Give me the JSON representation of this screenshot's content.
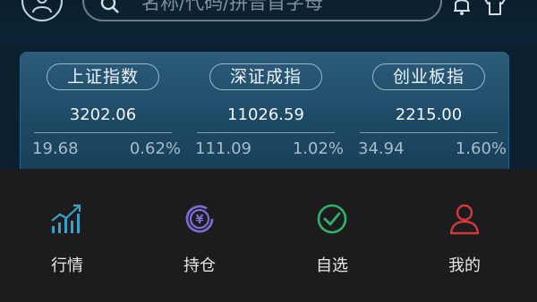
{
  "search": {
    "placeholder": "名称/代码/拼音首字母"
  },
  "indices": [
    {
      "name": "上证指数",
      "price": "3202.06",
      "change": "19.68",
      "percent": "0.62%"
    },
    {
      "name": "深证成指",
      "price": "11026.59",
      "change": "111.09",
      "percent": "1.02%"
    },
    {
      "name": "创业板指",
      "price": "2215.00",
      "change": "34.94",
      "percent": "1.60%"
    }
  ],
  "tabs": [
    {
      "label": "行情",
      "icon": "market-chart-icon",
      "color": "#3aa0c8"
    },
    {
      "label": "持仓",
      "icon": "yuan-coin-icon",
      "color": "#7b6fd6"
    },
    {
      "label": "自选",
      "icon": "check-circle-icon",
      "color": "#2fb36a"
    },
    {
      "label": "我的",
      "icon": "user-icon",
      "color": "#d23a3a"
    }
  ]
}
